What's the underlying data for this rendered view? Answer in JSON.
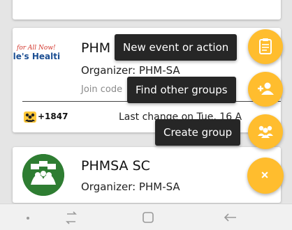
{
  "groups": [
    {
      "logo_text_line1": "for All Now!",
      "logo_text_line2": "ple's Healti",
      "name": "PHM",
      "organizer": "Organizer: PHM-SA",
      "join_code_label": "Join code",
      "members": "+1847",
      "last_change": "Last change on Tue, 16 A"
    },
    {
      "name": "PHMSA SC",
      "organizer": "Organizer: PHM-SA"
    }
  ],
  "fab_menu": {
    "new_event_label": "New event or action",
    "find_groups_label": "Find other groups",
    "create_group_label": "Create group",
    "icons": {
      "new_event": "clipboard-icon",
      "find_groups": "add-person-icon",
      "create_group": "group-icon",
      "close": "close-icon"
    }
  },
  "colors": {
    "fab": "#ffbd2e",
    "label_bg": "#262626",
    "logo_green": "#2e7d32"
  },
  "navbar": {
    "icons": [
      "dot-icon",
      "recent-apps-icon",
      "home-icon",
      "back-icon"
    ]
  }
}
